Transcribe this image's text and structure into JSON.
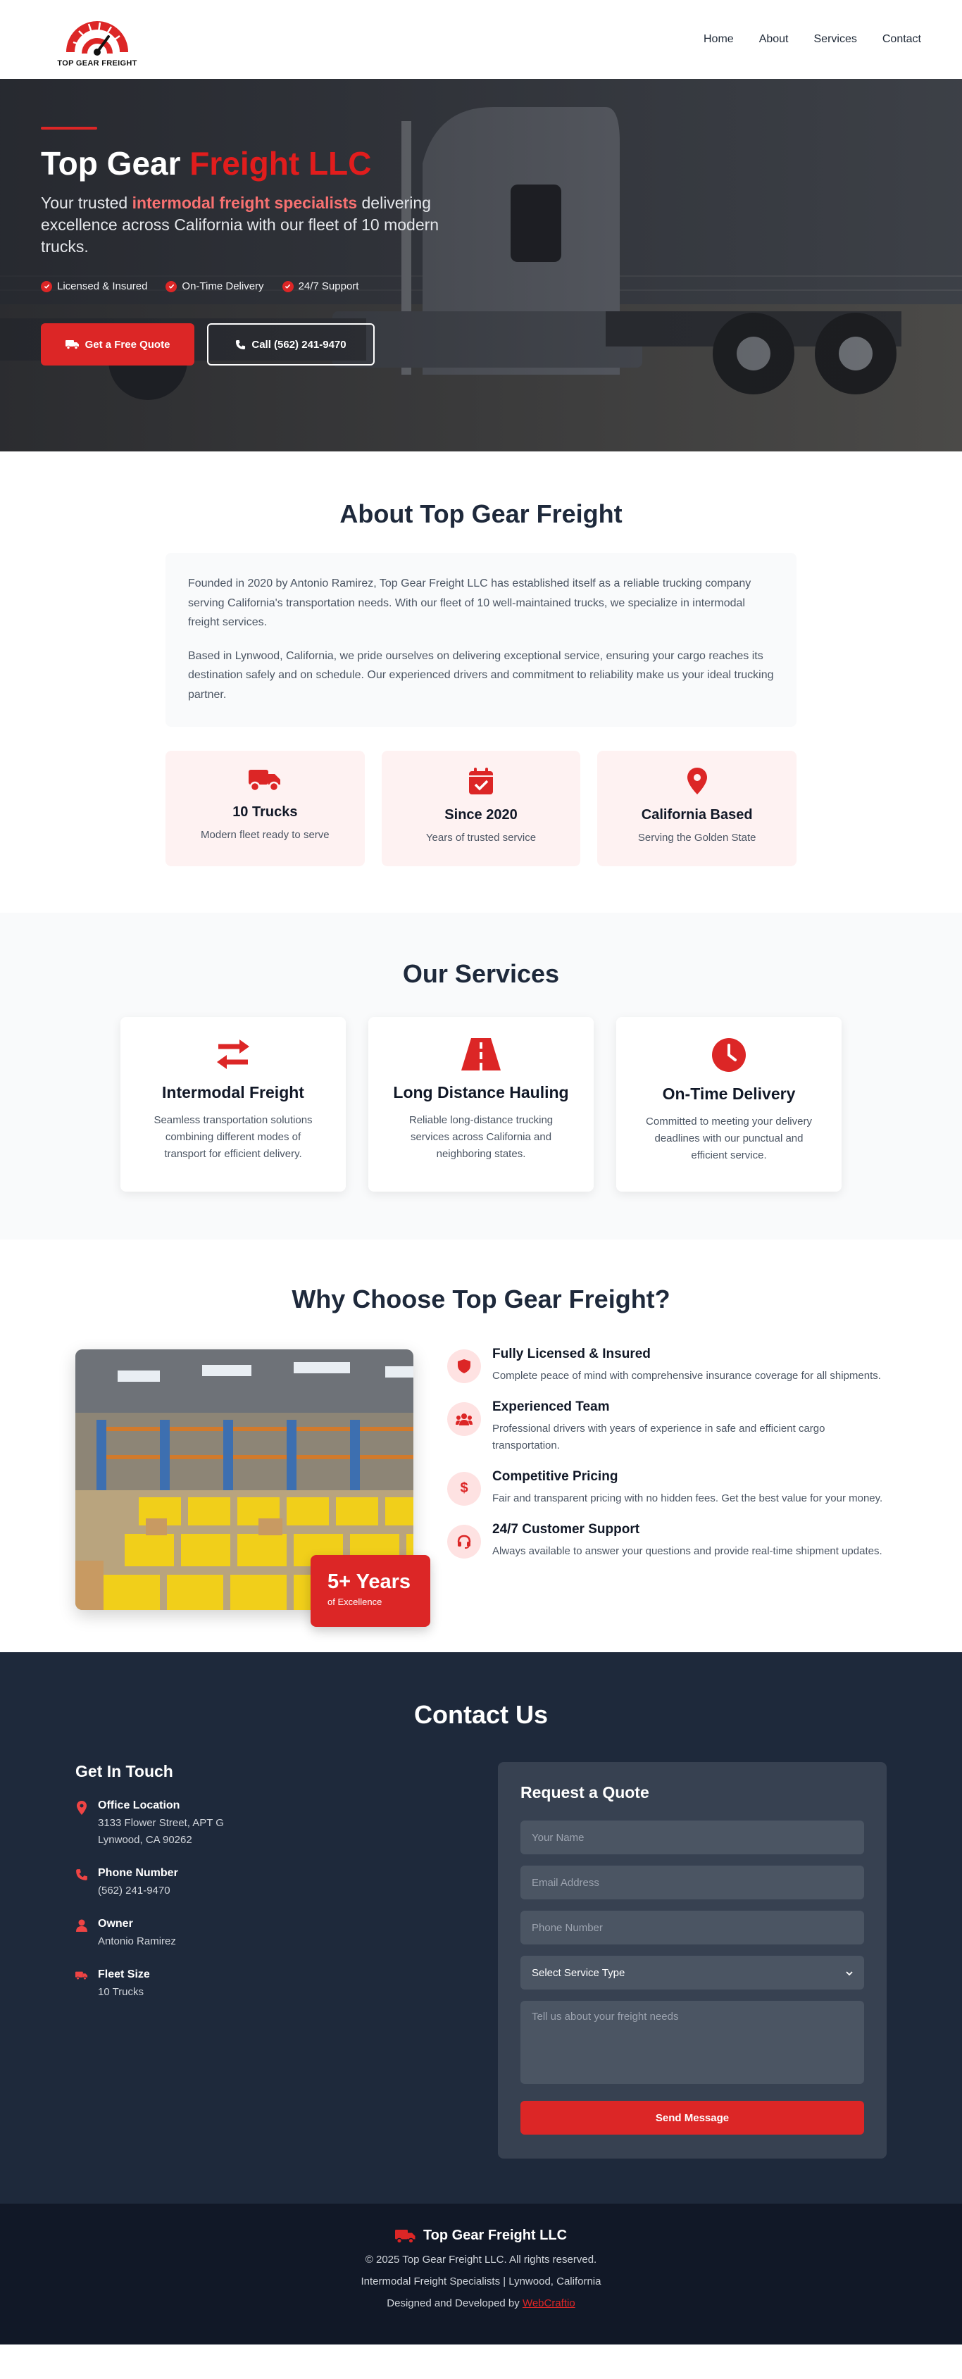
{
  "brand": {
    "logo_text": "TOP GEAR FREIGHT",
    "accent": "#dc2626"
  },
  "nav": {
    "items": [
      "Home",
      "About",
      "Services",
      "Contact"
    ]
  },
  "hero": {
    "title_part1": "Top Gear ",
    "title_part2": "Freight LLC",
    "subtitle_pre": "Your trusted ",
    "subtitle_highlight": "intermodal freight specialists",
    "subtitle_post": " delivering excellence across California with our fleet of 10 modern trucks.",
    "badges": [
      "Licensed & Insured",
      "On-Time Delivery",
      "24/7 Support"
    ],
    "primary_btn": "Get a Free Quote",
    "secondary_btn": "Call (562) 241-9470"
  },
  "about": {
    "title": "About Top Gear Freight",
    "paragraphs": [
      "Founded in 2020 by Antonio Ramirez, Top Gear Freight LLC has established itself as a reliable trucking company serving California's transportation needs. With our fleet of 10 well-maintained trucks, we specialize in intermodal freight services.",
      "Based in Lynwood, California, we pride ourselves on delivering exceptional service, ensuring your cargo reaches its destination safely and on schedule. Our experienced drivers and commitment to reliability make us your ideal trucking partner."
    ],
    "stats": [
      {
        "icon": "truck-icon",
        "title": "10 Trucks",
        "sub": "Modern fleet ready to serve"
      },
      {
        "icon": "calendar-check-icon",
        "title": "Since 2020",
        "sub": "Years of trusted service"
      },
      {
        "icon": "map-pin-icon",
        "title": "California Based",
        "sub": "Serving the Golden State"
      }
    ]
  },
  "services": {
    "title": "Our Services",
    "items": [
      {
        "icon": "exchange-arrows-icon",
        "title": "Intermodal Freight",
        "desc": "Seamless transportation solutions combining different modes of transport for efficient delivery."
      },
      {
        "icon": "road-icon",
        "title": "Long Distance Hauling",
        "desc": "Reliable long-distance trucking services across California and neighboring states."
      },
      {
        "icon": "clock-icon",
        "title": "On-Time Delivery",
        "desc": "Committed to meeting your delivery deadlines with our punctual and efficient service."
      }
    ]
  },
  "why": {
    "title": "Why Choose Top Gear Freight?",
    "years_num": "5+ Years",
    "years_lbl": "of Excellence",
    "items": [
      {
        "icon": "shield-icon",
        "title": "Fully Licensed & Insured",
        "desc": "Complete peace of mind with comprehensive insurance coverage for all shipments."
      },
      {
        "icon": "team-icon",
        "title": "Experienced Team",
        "desc": "Professional drivers with years of experience in safe and efficient cargo transportation."
      },
      {
        "icon": "dollar-icon",
        "title": "Competitive Pricing",
        "desc": "Fair and transparent pricing with no hidden fees. Get the best value for your money."
      },
      {
        "icon": "headset-icon",
        "title": "24/7 Customer Support",
        "desc": "Always available to answer your questions and provide real-time shipment updates."
      }
    ]
  },
  "contact": {
    "title": "Contact Us",
    "git_title": "Get In Touch",
    "info": [
      {
        "icon": "map-pin-icon",
        "label": "Office Location",
        "value1": "3133 Flower Street, APT G",
        "value2": "Lynwood, CA 90262"
      },
      {
        "icon": "phone-icon",
        "label": "Phone Number",
        "value1": "(562) 241-9470",
        "value2": ""
      },
      {
        "icon": "user-icon",
        "label": "Owner",
        "value1": "Antonio Ramirez",
        "value2": ""
      },
      {
        "icon": "truck-icon",
        "label": "Fleet Size",
        "value1": "10 Trucks",
        "value2": ""
      }
    ],
    "quote": {
      "title": "Request a Quote",
      "name_ph": "Your Name",
      "email_ph": "Email Address",
      "phone_ph": "Phone Number",
      "service_selected": "Select Service Type",
      "message_ph": "Tell us about your freight needs",
      "submit": "Send Message"
    }
  },
  "footer": {
    "brand": "Top Gear Freight LLC",
    "copyright": "© 2025 Top Gear Freight LLC. All rights reserved.",
    "tagline": "Intermodal Freight Specialists | Lynwood, California",
    "credit_pre": "Designed and Developed by ",
    "credit_link": "WebCraftio"
  }
}
